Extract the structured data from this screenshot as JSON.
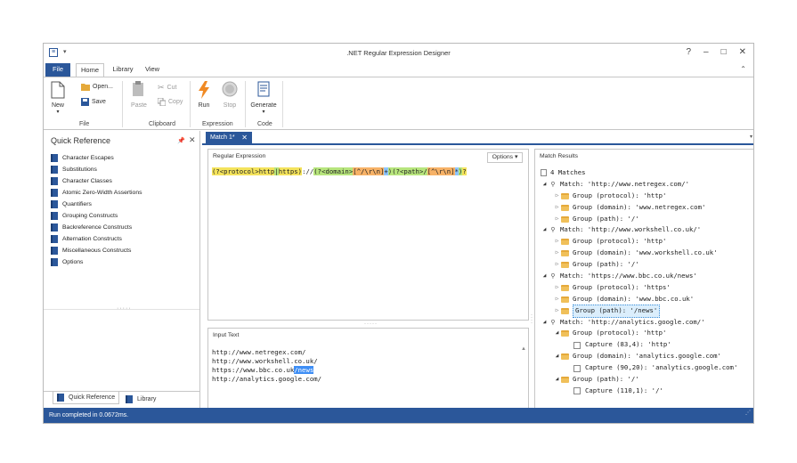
{
  "window": {
    "title": ".NET Regular Expression Designer",
    "controls": {
      "help": "?",
      "minimize": "–",
      "maximize": "□",
      "close": "✕"
    }
  },
  "ribbon": {
    "tabs": [
      {
        "label": "File"
      },
      {
        "label": "Home"
      },
      {
        "label": "Library"
      },
      {
        "label": "View"
      }
    ],
    "file_group": {
      "new_label": "New",
      "open_label": "Open...",
      "save_label": "Save",
      "group_label": "File"
    },
    "clipboard_group": {
      "paste_label": "Paste",
      "cut_label": "Cut",
      "copy_label": "Copy",
      "group_label": "Clipboard"
    },
    "expression_group": {
      "run_label": "Run",
      "stop_label": "Stop",
      "group_label": "Expression"
    },
    "code_group": {
      "generate_label": "Generate",
      "group_label": "Code"
    }
  },
  "quick_reference": {
    "title": "Quick Reference",
    "items": [
      "Character Escapes",
      "Substitutions",
      "Character Classes",
      "Atomic Zero-Width Assertions",
      "Quantifiers",
      "Grouping Constructs",
      "Backreference Constructs",
      "Alternation Constructs",
      "Miscellaneous Constructs",
      "Options"
    ],
    "bottom_tabs": {
      "quick_reference": "Quick Reference",
      "library": "Library"
    }
  },
  "document": {
    "tab_label": "Match 1*"
  },
  "regex_panel": {
    "title": "Regular Expression",
    "options_label": "Options",
    "tokens": [
      {
        "text": "(?<protocol>http",
        "hl": "y"
      },
      {
        "text": "|",
        "hl": "g"
      },
      {
        "text": "https",
        "hl": "y"
      },
      {
        "text": ")",
        "hl": "y"
      },
      {
        "text": "://",
        "hl": ""
      },
      {
        "text": "(",
        "hl": "g"
      },
      {
        "text": "?<domain>",
        "hl": "g"
      },
      {
        "text": "[^/\\r\\n]",
        "hl": "o"
      },
      {
        "text": "+",
        "hl": "b"
      },
      {
        "text": ")",
        "hl": "g"
      },
      {
        "text": "(?<path>/",
        "hl": "g"
      },
      {
        "text": "[^\\r\\n]",
        "hl": "o"
      },
      {
        "text": "*",
        "hl": "b"
      },
      {
        "text": ")",
        "hl": "g"
      },
      {
        "text": "?",
        "hl": "y"
      }
    ]
  },
  "input_panel": {
    "title": "Input Text",
    "lines": [
      {
        "text": "http://www.netregex.com/",
        "selected": ""
      },
      {
        "text": "http://www.workshell.co.uk/",
        "selected": ""
      },
      {
        "text": "https://www.bbc.co.uk",
        "selected": "/news"
      },
      {
        "text": "http://analytics.google.com/",
        "selected": ""
      }
    ]
  },
  "match_results": {
    "title": "Match Results",
    "summary": "4 Matches",
    "nodes": [
      {
        "kind": "match",
        "text": "Match: 'http://www.netregex.com/'",
        "level": 1,
        "open": true
      },
      {
        "kind": "group",
        "text": "Group (protocol): 'http'",
        "level": 2,
        "open": false
      },
      {
        "kind": "group",
        "text": "Group (domain): 'www.netregex.com'",
        "level": 2,
        "open": false
      },
      {
        "kind": "group",
        "text": "Group (path): '/'",
        "level": 2,
        "open": false
      },
      {
        "kind": "match",
        "text": "Match: 'http://www.workshell.co.uk/'",
        "level": 1,
        "open": true
      },
      {
        "kind": "group",
        "text": "Group (protocol): 'http'",
        "level": 2,
        "open": false
      },
      {
        "kind": "group",
        "text": "Group (domain): 'www.workshell.co.uk'",
        "level": 2,
        "open": false
      },
      {
        "kind": "group",
        "text": "Group (path): '/'",
        "level": 2,
        "open": false
      },
      {
        "kind": "match",
        "text": "Match: 'https://www.bbc.co.uk/news'",
        "level": 1,
        "open": true
      },
      {
        "kind": "group",
        "text": "Group (protocol): 'https'",
        "level": 2,
        "open": false
      },
      {
        "kind": "group",
        "text": "Group (domain): 'www.bbc.co.uk'",
        "level": 2,
        "open": false
      },
      {
        "kind": "group",
        "text": "Group (path): '/news'",
        "level": 2,
        "open": false,
        "selected": true
      },
      {
        "kind": "match",
        "text": "Match: 'http://analytics.google.com/'",
        "level": 1,
        "open": true
      },
      {
        "kind": "group",
        "text": "Group (protocol): 'http'",
        "level": 2,
        "open": true
      },
      {
        "kind": "capture",
        "text": "Capture (83,4): 'http'",
        "level": 3
      },
      {
        "kind": "group",
        "text": "Group (domain): 'analytics.google.com'",
        "level": 2,
        "open": true
      },
      {
        "kind": "capture",
        "text": "Capture (90,20): 'analytics.google.com'",
        "level": 3
      },
      {
        "kind": "group",
        "text": "Group (path): '/'",
        "level": 2,
        "open": true
      },
      {
        "kind": "capture",
        "text": "Capture (110,1): '/'",
        "level": 3
      }
    ]
  },
  "status": {
    "text": "Run completed in 0.0672ms."
  },
  "colors": {
    "accent": "#2b579a",
    "regex_group": "#f4e35c",
    "regex_named_group": "#b7e57d",
    "regex_charclass": "#f7b267",
    "regex_quantifier": "#8ec5ff",
    "selection": "#3e8ef5"
  },
  "icons": {
    "new": "new-document-icon",
    "open": "open-folder-icon",
    "save": "save-disk-icon",
    "paste": "paste-clipboard-icon",
    "cut": "scissors-icon",
    "copy": "copy-icon",
    "run": "lightning-run-icon",
    "stop": "stop-circle-icon",
    "generate": "code-generate-icon",
    "book": "book-icon",
    "match": "match-icon",
    "folder": "folder-icon",
    "capture": "capture-checkbox-icon"
  }
}
